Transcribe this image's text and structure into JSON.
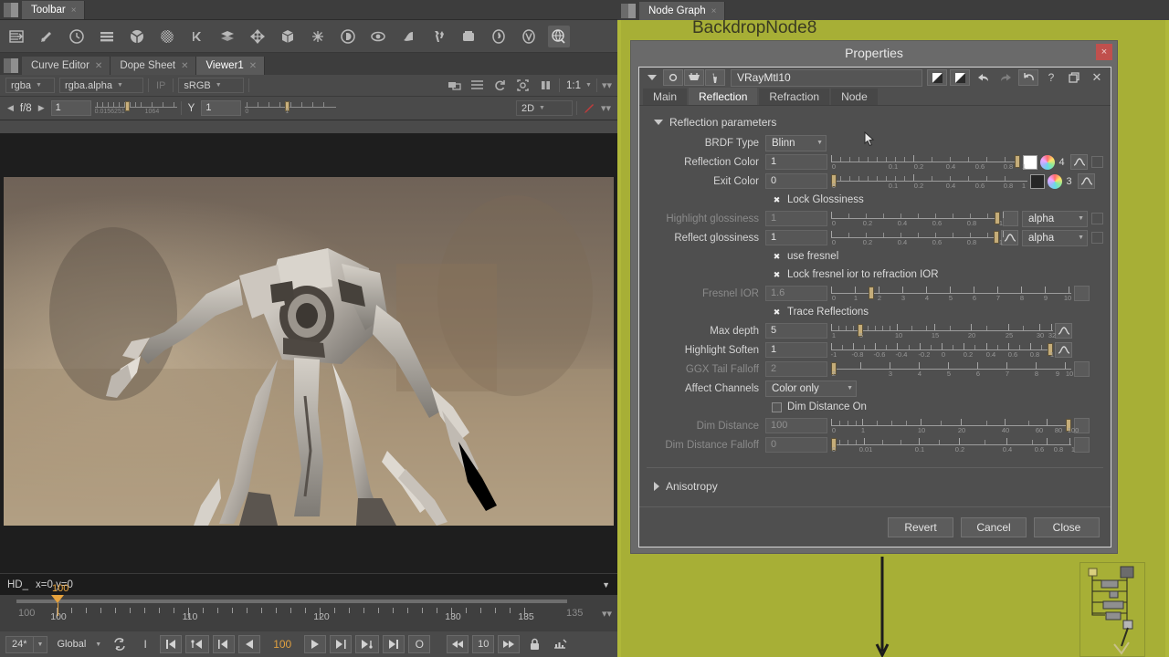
{
  "left_panel": {
    "toolbar_tab": {
      "label": "Toolbar",
      "close": "×"
    },
    "toolbar_icons": [
      "import-icon",
      "paint-icon",
      "clock-icon",
      "layers-stack-icon",
      "merge-icon",
      "checker-icon",
      "keyer-icon",
      "layer-icon",
      "transform-icon",
      "cube-3d-icon",
      "particles-icon",
      "deep-icon",
      "ellipse-icon",
      "shuffle-icon",
      "tools-icon",
      "box-icon",
      "furnace-icon",
      "vray-icon",
      "globe-icon"
    ],
    "editor_tabs": [
      {
        "label": "Curve Editor",
        "active": false
      },
      {
        "label": "Dope Sheet",
        "active": false
      },
      {
        "label": "Viewer1",
        "active": true
      }
    ],
    "channel_controls": {
      "channel": "rgba",
      "layer": "rgba.alpha",
      "ip_label": "IP",
      "colorspace": "sRGB",
      "zoom": "1:1",
      "mode": "2D"
    },
    "exposure_row": {
      "stop_label": "f/8",
      "gain_value": "1",
      "gain_min": "0.0156251",
      "gain_max": "1064",
      "gamma_label": "Y",
      "gamma_value": "1",
      "gamma_min": "0",
      "gamma_mid": "1"
    },
    "status_bar": {
      "format": "HD_",
      "coords": "x=0 y=0"
    },
    "timeline": {
      "in_frame": "100",
      "out_frame": "135",
      "current_frame": "100",
      "playhead_label": "100",
      "tick_labels": [
        "100",
        "110",
        "120",
        "130",
        "135"
      ]
    },
    "transport": {
      "fps": "24*",
      "sync": "Global",
      "current_frame": "100",
      "step": "10",
      "buttons": [
        "loop-icon",
        "insert-key-icon",
        "first-frame-icon",
        "prev-key-icon",
        "prev-frame-step-icon",
        "play-backward-icon",
        "play-forward-icon",
        "play-forward-step-icon",
        "next-key-icon",
        "last-frame-icon",
        "out-point-icon",
        "rewind-icon",
        "fast-forward-icon",
        "lock-icon",
        "keyframe-icon"
      ]
    }
  },
  "node_graph": {
    "tab": {
      "label": "Node Graph",
      "close": "×"
    },
    "backdrop_label": "BackdropNode8",
    "backdrop_color": "#a7af36"
  },
  "properties": {
    "title": "Properties",
    "close_label": "×",
    "node_name": "VRayMtl10",
    "header_icons": [
      "disclosure-triangle-icon",
      "node-color-icon",
      "mask-icon",
      "wrench-icon",
      "split-a-icon",
      "split-b-icon",
      "undo-icon",
      "redo-icon",
      "reload-icon",
      "help-icon",
      "float-icon",
      "close-icon"
    ],
    "tabs": [
      {
        "label": "Main",
        "active": false
      },
      {
        "label": "Reflection",
        "active": true
      },
      {
        "label": "Refraction",
        "active": false
      },
      {
        "label": "Node",
        "active": false
      }
    ],
    "group_title": "Reflection parameters",
    "brdf": {
      "label": "BRDF Type",
      "value": "Blinn"
    },
    "params": [
      {
        "name": "reflection-color",
        "label": "Reflection Color",
        "value": "1",
        "dim": false,
        "slider": {
          "min": 0,
          "max": 1,
          "handle": 1,
          "ticks": [
            "0",
            "0.1",
            "0.2",
            "0.4",
            "0.6",
            "0.8",
            "1"
          ]
        },
        "swatch": "#ffffff",
        "channels": "4",
        "has_wheel": true,
        "has_curve": true
      },
      {
        "name": "exit-color",
        "label": "Exit Color",
        "value": "0",
        "dim": false,
        "slider": {
          "min": 0,
          "max": 1,
          "handle": 0,
          "ticks": [
            "0",
            "0.1",
            "0.2",
            "0.4",
            "0.6",
            "0.8",
            "1"
          ]
        },
        "swatch": "#262626",
        "channels": "3",
        "has_wheel": true,
        "has_curve": true
      },
      {
        "name": "highlight-glossiness",
        "label": "Highlight glossiness",
        "value": "1",
        "dim": true,
        "slider": {
          "min": 0,
          "max": 1,
          "handle": 1,
          "ticks": [
            "0",
            "0.2",
            "0.4",
            "0.6",
            "0.8",
            "1"
          ]
        },
        "dropdown": "alpha"
      },
      {
        "name": "reflect-glossiness",
        "label": "Reflect glossiness",
        "value": "1",
        "dim": false,
        "slider": {
          "min": 0,
          "max": 1,
          "handle": 1,
          "ticks": [
            "0",
            "0.2",
            "0.4",
            "0.6",
            "0.8",
            "1"
          ]
        },
        "dropdown": "alpha",
        "has_curve": true
      },
      {
        "name": "fresnel-ior",
        "label": "Fresnel IOR",
        "value": "1.6",
        "dim": true,
        "slider": {
          "min": 0,
          "max": 10,
          "handle": 1.6,
          "ticks": [
            "0",
            "1",
            "2",
            "3",
            "4",
            "5",
            "6",
            "7",
            "8",
            "9",
            "10"
          ]
        }
      },
      {
        "name": "max-depth",
        "label": "Max depth",
        "value": "5",
        "dim": false,
        "slider": {
          "min": 1,
          "max": 32,
          "handle": 5,
          "ticks": [
            "1",
            "5",
            "10",
            "15",
            "20",
            "25",
            "30",
            "32"
          ]
        },
        "has_curve": true
      },
      {
        "name": "highlight-soften",
        "label": "Highlight Soften",
        "value": "1",
        "dim": false,
        "slider": {
          "min": -1,
          "max": 1,
          "handle": 1,
          "ticks": [
            "-1",
            "-0.8",
            "-0.6",
            "-0.4",
            "-0.2",
            "0",
            "0.2",
            "0.4",
            "0.6",
            "0.8",
            "1"
          ]
        },
        "has_curve": true
      },
      {
        "name": "ggx-tail-falloff",
        "label": "GGX Tail Falloff",
        "value": "2",
        "dim": true,
        "slider": {
          "min": 2,
          "max": 10,
          "handle": 2,
          "ticks": [
            "2",
            "3",
            "4",
            "5",
            "6",
            "7",
            "8",
            "9",
            "10"
          ]
        }
      },
      {
        "name": "dim-distance",
        "label": "Dim Distance",
        "value": "100",
        "dim": true,
        "slider": {
          "min": 0,
          "max": 100,
          "handle": 100,
          "ticks": [
            "0",
            "1",
            "10",
            "20",
            "40",
            "60",
            "80",
            "100"
          ]
        }
      },
      {
        "name": "dim-distance-falloff",
        "label": "Dim Distance Falloff",
        "value": "0",
        "dim": true,
        "slider": {
          "min": 0,
          "max": 1,
          "handle": 0,
          "ticks": [
            "0",
            "0.01",
            "0.1",
            "0.2",
            "0.4",
            "0.6",
            "0.8",
            "1"
          ]
        }
      }
    ],
    "checkboxes": [
      {
        "name": "lock-glossiness",
        "label": "Lock Glossiness",
        "checked": true
      },
      {
        "name": "use-fresnel",
        "label": "use fresnel",
        "checked": true
      },
      {
        "name": "lock-fresnel-ior",
        "label": "Lock fresnel ior to refraction IOR",
        "checked": true
      },
      {
        "name": "trace-reflections",
        "label": "Trace Reflections",
        "checked": true
      },
      {
        "name": "dim-distance-on",
        "label": "Dim Distance On",
        "checked": false
      }
    ],
    "affect_channels": {
      "label": "Affect Channels",
      "value": "Color only"
    },
    "anisotropy": {
      "label": "Anisotropy",
      "expanded": false
    },
    "footer_buttons": [
      {
        "name": "revert-button",
        "label": "Revert"
      },
      {
        "name": "cancel-button",
        "label": "Cancel"
      },
      {
        "name": "close-button",
        "label": "Close"
      }
    ],
    "check_glyph": "✖"
  }
}
